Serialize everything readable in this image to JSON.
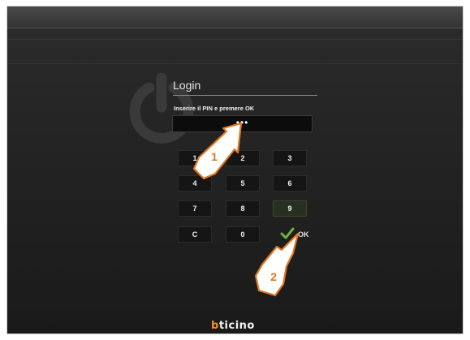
{
  "login": {
    "title": "Login",
    "instruction": "Inserire il PIN e premere OK",
    "pin_value": "•••"
  },
  "keypad": {
    "keys": [
      {
        "label": "1"
      },
      {
        "label": "2"
      },
      {
        "label": "3"
      },
      {
        "label": "4"
      },
      {
        "label": "5"
      },
      {
        "label": "6"
      },
      {
        "label": "7"
      },
      {
        "label": "8"
      },
      {
        "label": "9",
        "highlighted": true
      },
      {
        "label": "C"
      },
      {
        "label": "0"
      }
    ],
    "ok_label": "OK"
  },
  "callouts": [
    {
      "number": "1",
      "target": "pin-field"
    },
    {
      "number": "2",
      "target": "ok-key"
    }
  ],
  "brand": {
    "logo_text": "bticino",
    "colors": {
      "accent": "#f7941d",
      "ok_check": "#6db33f"
    }
  },
  "icons": [
    "power-icon",
    "checkmark-icon",
    "pointing-hand-icon"
  ]
}
